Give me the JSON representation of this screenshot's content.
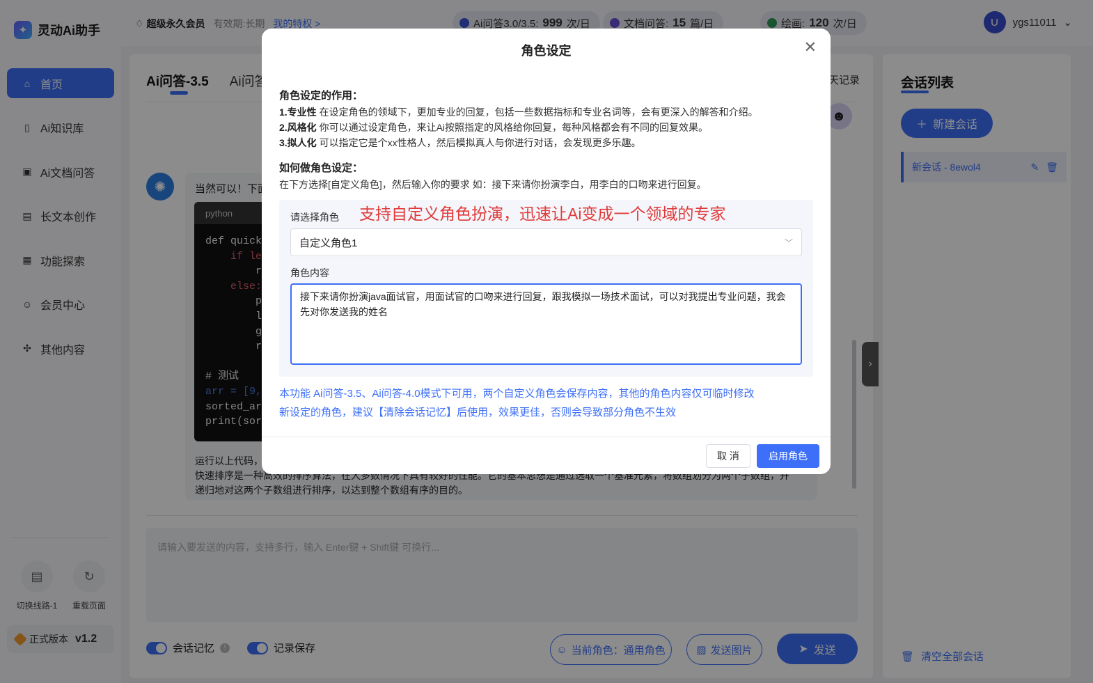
{
  "app": {
    "name": "灵动Ai助手",
    "version_label": "正式版本",
    "version": "v1.2"
  },
  "nav": {
    "items": [
      {
        "label": "首页",
        "icon": "home-icon"
      },
      {
        "label": "Ai知识库",
        "icon": "book-icon"
      },
      {
        "label": "Ai文档问答",
        "icon": "doc-ai-icon"
      },
      {
        "label": "长文本创作",
        "icon": "doc-icon"
      },
      {
        "label": "功能探索",
        "icon": "explore-icon"
      },
      {
        "label": "会员中心",
        "icon": "user-icon"
      },
      {
        "label": "其他内容",
        "icon": "grid-icon"
      }
    ]
  },
  "tools": {
    "switch_label": "切换线路-1",
    "reload_label": "重载页面"
  },
  "header": {
    "member": "超级永久会员",
    "validity": "有效期:长期",
    "privilege": "我的特权 >",
    "quota1_label": "Ai问答3.0/3.5:",
    "quota1_value": "999",
    "quota1_unit": "次/日",
    "quota2_label": "文档问答:",
    "quota2_value": "15",
    "quota2_unit": "篇/日",
    "quota3_label": "绘画:",
    "quota3_value": "120",
    "quota3_unit": "次/日",
    "user_initial": "U",
    "username": "ygs11011"
  },
  "chat": {
    "tab1": "Ai问答-3.5",
    "tab2": "Ai问答",
    "history": "天记录",
    "ai_intro": "当然可以！下面",
    "code_lang": "python",
    "code_lines": [
      "def quick_",
      "    if len",
      "        re",
      "    else:",
      "        pi",
      "        le",
      "        gr",
      "        re",
      "",
      "# 测试",
      "arr = [9,",
      "sorted_arr",
      "print(sort"
    ],
    "after_line1": "运行以上代码，",
    "after_line2": "快速排序是一种高效的排序算法，在大多数情况下具有较好的性能。它的基本思想是通过选取一个基准元素，将数组划分为两个子数组，并",
    "after_line3": "递归地对这两个子数组进行排序，以达到整个数组有序的目的。",
    "input_placeholder": "请输入要发送的内容，支持多行，输入 Enter键 + Shift键 可换行...",
    "memory_label": "会话记忆",
    "save_label": "记录保存",
    "role_btn": "当前角色：通用角色",
    "image_btn": "发送图片",
    "send_btn": "发送"
  },
  "right": {
    "title": "会话列表",
    "new_btn": "新建会话",
    "session": "新会话 - 8ewol4",
    "clear_all": "清空全部会话"
  },
  "modal": {
    "title": "角色设定",
    "sec1_title": "角色设定的作用：",
    "p1_b": "1.专业性",
    "p1": " 在设定角色的领域下，更加专业的回复，包括一些数据指标和专业名词等，会有更深入的解答和介绍。",
    "p2_b": "2.风格化",
    "p2": " 你可以通过设定角色，来让Ai按照指定的风格给你回复，每种风格都会有不同的回复效果。",
    "p3_b": "3.拟人化",
    "p3": " 可以指定它是个xx性格人，然后模拟真人与你进行对话，会发现更多乐趣。",
    "sec2_title": "如何做角色设定：",
    "how": "在下方选择[自定义角色]，然后输入你的要求 如：接下来请你扮演李白，用李白的口吻来进行回复。",
    "red_note": "支持自定义角色扮演，迅速让Ai变成一个领域的专家",
    "select_label": "请选择角色",
    "select_value": "自定义角色1",
    "content_label": "角色内容",
    "content_value": "接下来请你扮演java面试官，用面试官的口吻来进行回复，跟我模拟一场技术面试，可以对我提出专业问题，我会先对你发送我的姓名",
    "note1": "本功能 Ai问答-3.5、Ai问答-4.0模式下可用，两个自定义角色会保存内容，其他的角色内容仅可临时修改",
    "note2": "新设定的角色，建议【清除会话记忆】后使用，效果更佳，否则会导致部分角色不生效",
    "cancel": "取 消",
    "confirm": "启用角色"
  },
  "colors": {
    "accent": "#3d6ff8",
    "warning_red": "#e03a3a",
    "overlay": "rgba(0,0,0,0.45)"
  }
}
